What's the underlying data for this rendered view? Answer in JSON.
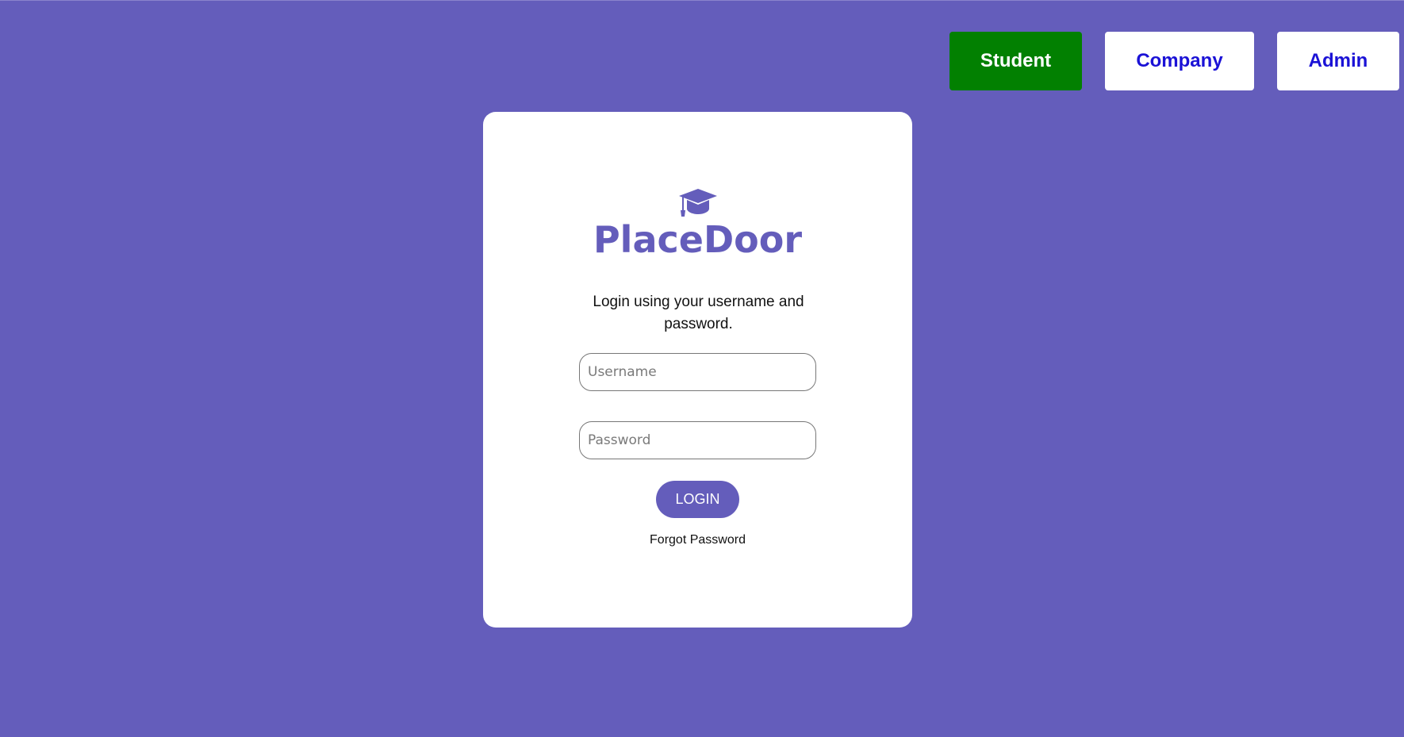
{
  "role_tabs": [
    {
      "label": "Student",
      "active": true,
      "color": "#028001"
    },
    {
      "label": "Company",
      "active": false,
      "color": "#1b12d6"
    },
    {
      "label": "Admin",
      "active": false,
      "color": "#1b12d6"
    }
  ],
  "login_card": {
    "logo_icon": "graduation-cap-icon",
    "brand_name": "PlaceDoor",
    "instructions": "Login using your username and password.",
    "username": {
      "value": "",
      "placeholder": "Username"
    },
    "password": {
      "value": "",
      "placeholder": "Password"
    },
    "login_label": "LOGIN",
    "forgot_password_label": "Forgot Password"
  },
  "colors": {
    "background": "#645dbb",
    "accent": "#645dbb",
    "active_tab": "#028001",
    "link_text": "#1b12d6"
  }
}
